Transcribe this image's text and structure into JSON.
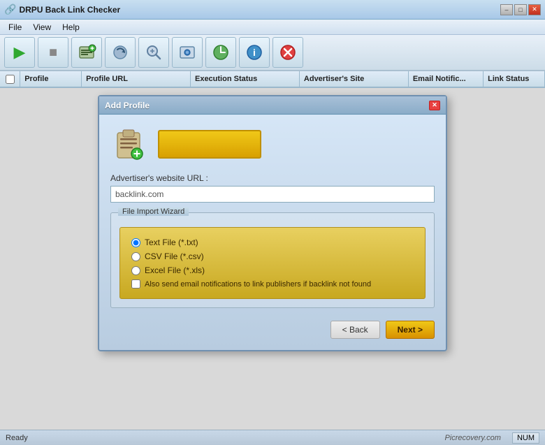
{
  "window": {
    "title": "DRPU Back Link Checker",
    "controls": {
      "minimize": "–",
      "maximize": "□",
      "close": "✕"
    }
  },
  "menu": {
    "items": [
      "File",
      "View",
      "Help"
    ]
  },
  "toolbar": {
    "buttons": [
      {
        "name": "play-button",
        "icon": "▶",
        "label": "Play"
      },
      {
        "name": "stop-button",
        "icon": "■",
        "label": "Stop"
      },
      {
        "name": "add-button",
        "icon": "➕",
        "label": "Add"
      },
      {
        "name": "refresh-button",
        "icon": "↺",
        "label": "Refresh"
      },
      {
        "name": "search-button",
        "icon": "🔍",
        "label": "Search"
      },
      {
        "name": "settings-button",
        "icon": "⚙",
        "label": "Settings"
      },
      {
        "name": "schedule-button",
        "icon": "⏰",
        "label": "Schedule"
      },
      {
        "name": "info-button",
        "icon": "ℹ",
        "label": "Info"
      },
      {
        "name": "close-button",
        "icon": "✖",
        "label": "Close"
      }
    ]
  },
  "table": {
    "headers": [
      "Profile",
      "Profile URL",
      "Execution Status",
      "Advertiser's Site",
      "Email Notific...",
      "Link Status"
    ],
    "checkbox_header": ""
  },
  "modal": {
    "title": "Add Profile",
    "close_btn": "✕",
    "heading": "Add Profile",
    "url_label": "Advertiser's website URL :",
    "url_placeholder": "backlink.com",
    "url_value": "backlink.com",
    "wizard_legend": "File Import Wizard",
    "file_options": [
      {
        "id": "txt",
        "label": "Text File (*.txt)",
        "checked": true
      },
      {
        "id": "csv",
        "label": "CSV File (*.csv)",
        "checked": false
      },
      {
        "id": "xls",
        "label": "Excel File (*.xls)",
        "checked": false
      }
    ],
    "email_checkbox_label": "Also send email notifications to link publishers if backlink not found",
    "email_checked": false,
    "back_btn": "< Back",
    "next_btn": "Next >"
  },
  "status": {
    "text": "Ready",
    "watermark": "Picrecovery.com",
    "num": "NUM"
  }
}
